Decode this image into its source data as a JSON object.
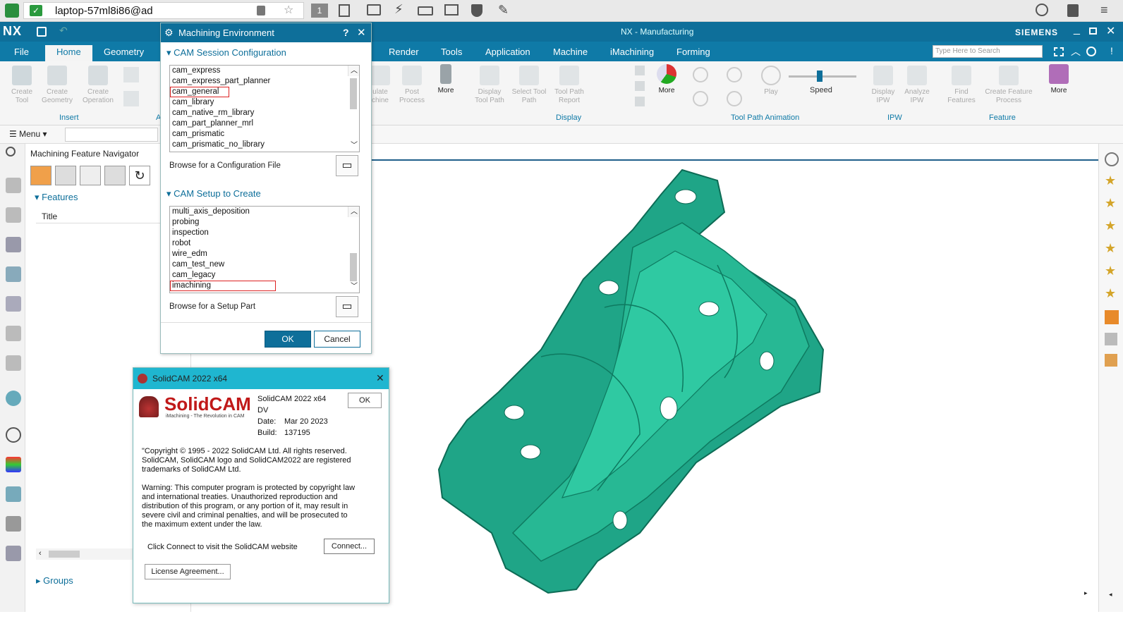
{
  "remote_toolbar": {
    "address": "laptop-57ml8i86@ad",
    "badge": "1"
  },
  "nx": {
    "logo": "NX",
    "window_title": "NX - Manufacturing",
    "brand": "SIEMENS",
    "search_placeholder": "Type Here to Search"
  },
  "menubar": {
    "file": "File",
    "home": "Home",
    "geometry": "Geometry",
    "render": "Render",
    "tools": "Tools",
    "application": "Application",
    "machine": "Machine",
    "imachining": "iMachining",
    "forming": "Forming"
  },
  "ribbon": {
    "create_tool": "Create Tool",
    "create_geometry": "Create Geometry",
    "create_operation": "Create Operation",
    "insert_group": "Insert",
    "a_group": "A",
    "simulate_machine": "ulate chine",
    "post_process": "Post Process",
    "more1": "More",
    "display_tool_path": "Display Tool Path",
    "select_tool_path": "Select Tool Path",
    "tool_path_report": "Tool Path Report",
    "more2": "More",
    "display_group": "Display",
    "play": "Play",
    "speed": "Speed",
    "tool_path_animation_group": "Tool Path Animation",
    "display_ipw": "Display IPW",
    "analyze_ipw": "Analyze IPW",
    "ipw_group": "IPW",
    "find_features": "Find Features",
    "create_feature_process": "Create Feature Process",
    "more3": "More",
    "feature_group": "Feature"
  },
  "bar2": {
    "menu": "Menu"
  },
  "navigator": {
    "title": "Machining Feature Navigator",
    "features": "Features",
    "column_title": "Title",
    "groups": "Groups"
  },
  "dialog": {
    "title": "Machining Environment",
    "help": "?",
    "session_section": "CAM Session Configuration",
    "session_items": [
      "cam_express",
      "cam_express_part_planner",
      "cam_general",
      "cam_library",
      "cam_native_rm_library",
      "cam_part_planner_mrl",
      "cam_prismatic",
      "cam_prismatic_no_library"
    ],
    "browse_config": "Browse for a Configuration File",
    "setup_section": "CAM Setup to Create",
    "setup_items": [
      "multi_axis_deposition",
      "probing",
      "inspection",
      "robot",
      "wire_edm",
      "cam_test_new",
      "cam_legacy",
      "imachining"
    ],
    "browse_setup": "Browse for a Setup Part",
    "ok": "OK",
    "cancel": "Cancel"
  },
  "solidcam": {
    "title": "SolidCAM 2022 x64",
    "logo_text": "SolidCAM",
    "logo_tagline": "iMachining - The Revolution in CAM",
    "product": "SolidCAM 2022 x64",
    "dv": "DV",
    "date_label": "Date:",
    "date_value": "Mar 20 2023",
    "build_label": "Build:",
    "build_value": "137195",
    "ok": "OK",
    "copyright": "\"Copyright © 1995 - 2022 SolidCAM Ltd. All rights reserved. SolidCAM, SolidCAM logo and SolidCAM2022 are registered trademarks of SolidCAM Ltd.",
    "warning": "Warning: This computer program is protected by copyright law and international treaties. Unauthorized reproduction and distribution of this program, or any portion of it, may result in severe civil and criminal penalties, and will be prosecuted to the maximum extent under the law.",
    "connect_text": "Click Connect to visit the SolidCAM website",
    "connect": "Connect...",
    "license": "License Agreement..."
  },
  "colors": {
    "nx_blue": "#0e6f9a",
    "solidcam_title": "#1fb6d0",
    "part_green": "#1fa587",
    "highlight_red": "#d22"
  }
}
